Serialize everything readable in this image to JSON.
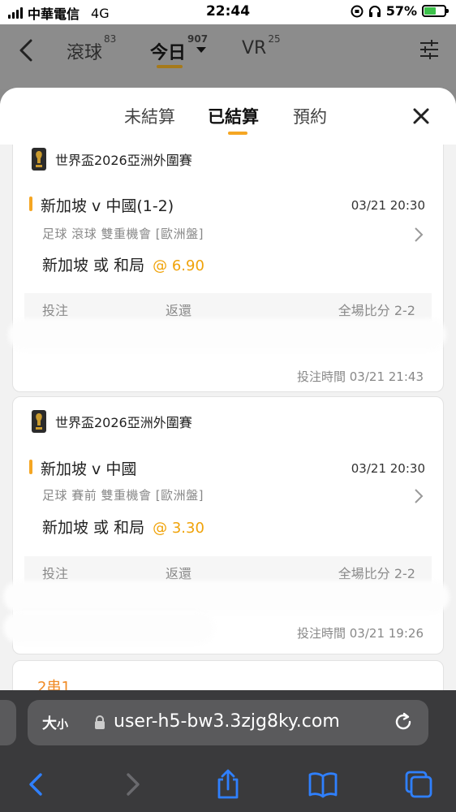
{
  "status_bar": {
    "carrier": "中華電信",
    "network": "4G",
    "time": "22:44",
    "battery": "57%",
    "battery_level": 0.57
  },
  "app_header": {
    "tabs": [
      {
        "label": "滾球",
        "count": "83"
      },
      {
        "label": "今日",
        "count": "907"
      },
      {
        "label": "VR",
        "count": "25"
      }
    ]
  },
  "sheet": {
    "tabs": [
      "未結算",
      "已結算",
      "預約"
    ],
    "active_tab": "已結算"
  },
  "bets": [
    {
      "league": "世界盃2026亞洲外圍賽",
      "match": "新加坡 v 中國(1-2)",
      "match_time": "03/21 20:30",
      "meta": "足球  滾球   雙重機會  [歐洲盤]",
      "selection": "新加坡 或 和局",
      "odds": "@ 6.90",
      "stake_label": "投注",
      "return_label": "返還",
      "score": "全場比分 2-2",
      "bet_time": "投注時間 03/21 21:43"
    },
    {
      "league": "世界盃2026亞洲外圍賽",
      "match": "新加坡 v 中國",
      "match_time": "03/21 20:30",
      "meta": "足球  賽前   雙重機會  [歐洲盤]",
      "selection": "新加坡 或 和局",
      "odds": "@ 3.30",
      "stake_label": "投注",
      "return_label": "返還",
      "score": "全場比分 2-2",
      "bet_time": "投注時間 03/21 19:26"
    }
  ],
  "parlay_label": "2串1",
  "browser": {
    "text_size": "大",
    "text_size_small": "小",
    "url": "user-h5-bw3.3zjg8ky.com"
  },
  "colors": {
    "accent": "#f5a623",
    "odds": "#f0a30a",
    "parlay": "#f08a24"
  }
}
